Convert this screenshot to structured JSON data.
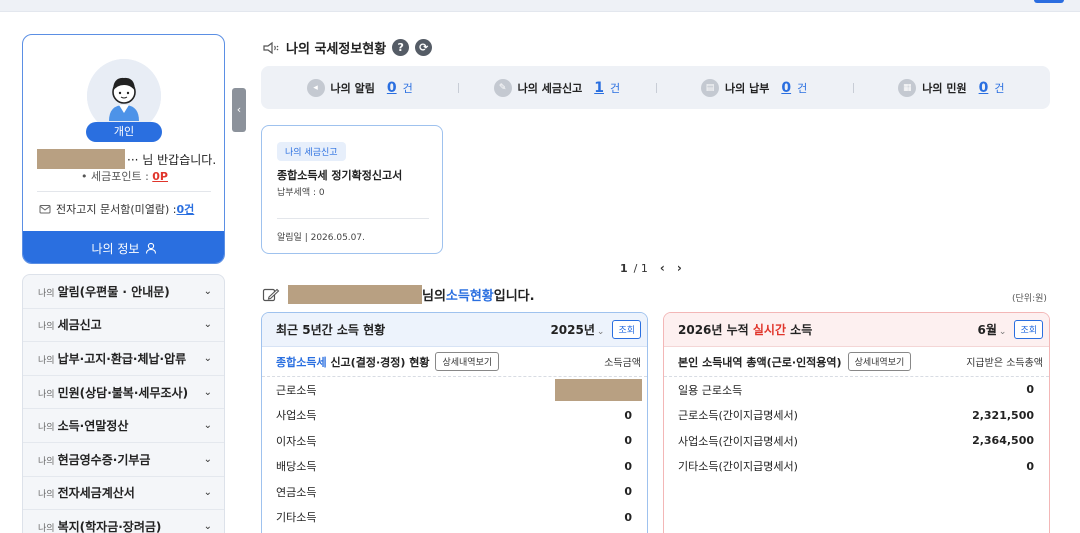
{
  "profile": {
    "badge": "개인",
    "greeting": "··· 님 반갑습니다.",
    "points_label": "• 세금포인트 : ",
    "points_value": "0P",
    "edoc_label": "전자고지 문서함(미열람) : ",
    "edoc_count": "0건",
    "myinfo_label": "나의 정보"
  },
  "menu": {
    "prefix": "나의",
    "items": [
      "알림(우편물 · 안내문)",
      "세금신고",
      "납부·고지·환급·체납·압류",
      "민원(상담·불복·세무조사)",
      "소득·연말정산",
      "현금영수증·기부금",
      "전자세금계산서",
      "복지(학자금·장려금)"
    ]
  },
  "status": {
    "title": "나의 국세정보현황",
    "items": [
      {
        "label": "나의 알림",
        "count": "0",
        "unit": "건"
      },
      {
        "label": "나의 세금신고",
        "count": "1",
        "unit": "건"
      },
      {
        "label": "나의 납부",
        "count": "0",
        "unit": "건"
      },
      {
        "label": "나의 민원",
        "count": "0",
        "unit": "건"
      }
    ]
  },
  "notice_card": {
    "tag": "나의 세금신고",
    "title": "종합소득세 정기확정신고서",
    "amount": "납부세액 : 0",
    "date": "알림일  |  2026.05.07."
  },
  "pager": {
    "current": "1",
    "total": "/ 1"
  },
  "income": {
    "suffix_pre": "님의 ",
    "highlight": "소득현황",
    "suffix_post": " 입니다.",
    "unit": "(단위:원)"
  },
  "panel_left": {
    "title": "최근 5년간 소득 현황",
    "year": "2025년",
    "query": "조회",
    "sub_highlight": "종합소득세",
    "sub_rest": " 신고(결정·경정) 현황",
    "detail_button": "상세내역보기",
    "col_header": "소득금액",
    "rows": [
      {
        "label": "근로소득",
        "value": ""
      },
      {
        "label": "사업소득",
        "value": "0"
      },
      {
        "label": "이자소득",
        "value": "0"
      },
      {
        "label": "배당소득",
        "value": "0"
      },
      {
        "label": "연금소득",
        "value": "0"
      },
      {
        "label": "기타소득",
        "value": "0"
      }
    ]
  },
  "panel_right": {
    "title_pre": "2026년 누적 ",
    "title_rt": "실시간",
    "title_post": " 소득",
    "month": "6월",
    "query": "조회",
    "sub_title": "본인 소득내역 총액(근로·인적용역)",
    "detail_button": "상세내역보기",
    "col_header": "지급받은 소득총액",
    "rows": [
      {
        "label": "일용 근로소득",
        "value": "0"
      },
      {
        "label": "근로소득(간이지급명세서)",
        "value": "2,321,500"
      },
      {
        "label": "사업소득(간이지급명세서)",
        "value": "2,364,500"
      },
      {
        "label": "기타소득(간이지급명세서)",
        "value": "0"
      }
    ]
  }
}
